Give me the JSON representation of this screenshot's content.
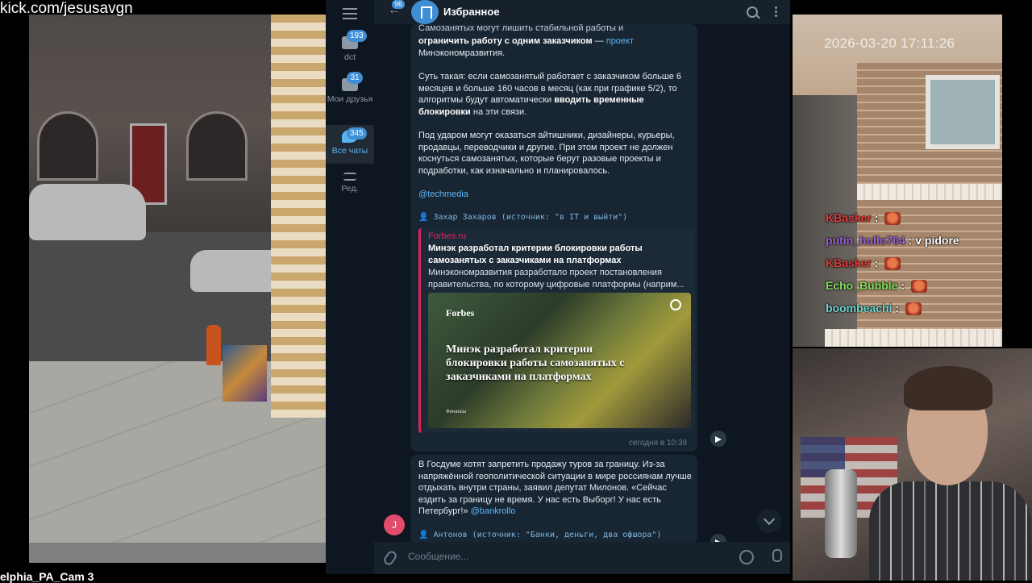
{
  "stream": {
    "url": "kick.com/jesusavgn",
    "left_cam_label": "elphia_PA_Cam 3",
    "right_cam_timestamp": "2026-03-20 17:11:26"
  },
  "chat": [
    {
      "user": "KBasker",
      "color": "#e03a3a",
      "message": "",
      "emote": true
    },
    {
      "user": "putin_hullo764",
      "color": "#9d5fd6",
      "message": "v pidore",
      "emote": false
    },
    {
      "user": "KBasker",
      "color": "#e03a3a",
      "message": "",
      "emote": true
    },
    {
      "user": "Echo_Bubble",
      "color": "#7fe05a",
      "message": "",
      "emote": true
    },
    {
      "user": "boombeachi",
      "color": "#6fd6d0",
      "message": "",
      "emote": true
    }
  ],
  "telegram": {
    "back_count": "96",
    "title": "Избранное",
    "folders": [
      {
        "label": "dct",
        "badge": "193"
      },
      {
        "label": "Мои друзья",
        "badge": "31"
      },
      {
        "label": "Все чаты",
        "badge": "345"
      },
      {
        "label": "Ред.",
        "badge": ""
      }
    ],
    "msg1": {
      "top_fragment": "Самозанятых могут лишить стабильной работы и",
      "line1_bold": "ограничить работу с одним заказчиком",
      "line1_dash": " — ",
      "line1_link": "проект",
      "line2": "Минэкономразвития.",
      "p2_start": "Суть такая: если самозанятый работает с заказчиком больше 6 месяцев и больше 160 часов в месяц (как при графике 5/2), то алгоритмы будут автоматически ",
      "p2_bold": "вводить временные блокировки",
      "p2_end": " на эти связи.",
      "p3": "Под ударом могут оказаться айтишники, дизайнеры, курьеры, продавцы, переводчики и другие. При этом проект не должен коснуться самозанятых, которые берут разовые проекты и подработки, как изначально и планировалось.",
      "hashtag": "@techmedia",
      "forwarded": "👤 Захар Захаров (источник: \"в IT и выйти\")",
      "preview": {
        "site": "Forbes.ru",
        "title": "Минэк разработал критерии блокировки работы самозанятых с заказчиками на платформах",
        "description": "Минэкономразвития разработало проект постановления правительства, по которому цифровые платформы (наприм...",
        "image_brand": "Forbes",
        "image_headline": "Минэк разработал критерии блокировки работы самозанятых с заказчиками на платформах",
        "image_small": "Финансы"
      },
      "time": "сегодня в 10:39"
    },
    "msg2": {
      "text": "В Госдуме хотят запретить продажу туров за границу. Из-за напряжённой геополитической ситуации в мире россиянам лучше отдыхать внутри страны, заявил депутат Милонов. «Сейчас ездить за границу не время. У нас есть Выборг! У нас есть Петербург!» ",
      "link": "@bankrollo",
      "forwarded": "👤 Антонов (источник: \"Банки, деньги, два офшора\")"
    },
    "avatar_letter": "J",
    "input_placeholder": "Сообщение..."
  }
}
